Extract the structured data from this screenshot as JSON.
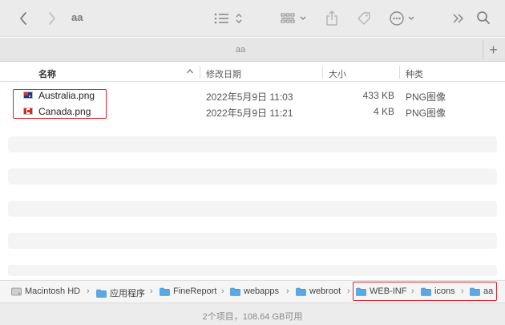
{
  "window": {
    "title": "aa"
  },
  "tab": {
    "title": "aa",
    "add_label": "+"
  },
  "columns": {
    "name": "名称",
    "date": "修改日期",
    "size": "大小",
    "kind": "种类"
  },
  "files": [
    {
      "name": "Australia.png",
      "date": "2022年5月9日 11:03",
      "size": "433 KB",
      "kind": "PNG图像",
      "flag": "australia-flag-icon"
    },
    {
      "name": "Canada.png",
      "date": "2022年5月9日 11:21",
      "size": "4 KB",
      "kind": "PNG图像",
      "flag": "canada-flag-icon"
    }
  ],
  "path": [
    {
      "label": "Macintosh HD",
      "icon": "hard-drive-icon"
    },
    {
      "label": "应用程序",
      "icon": "folder-icon"
    },
    {
      "label": "FineReport",
      "icon": "folder-icon"
    },
    {
      "label": "webapps",
      "icon": "folder-icon"
    },
    {
      "label": "webroot",
      "icon": "folder-icon"
    },
    {
      "label": "WEB-INF",
      "icon": "folder-icon"
    },
    {
      "label": "icons",
      "icon": "folder-icon"
    },
    {
      "label": "aa",
      "icon": "folder-icon"
    }
  ],
  "path_separator": "›",
  "status": {
    "text": "2个项目，108.64 GB可用"
  },
  "colors": {
    "highlight": "#d8262e",
    "folder": "#5aa9e6",
    "toolbar_bg": "#ebebeb"
  }
}
